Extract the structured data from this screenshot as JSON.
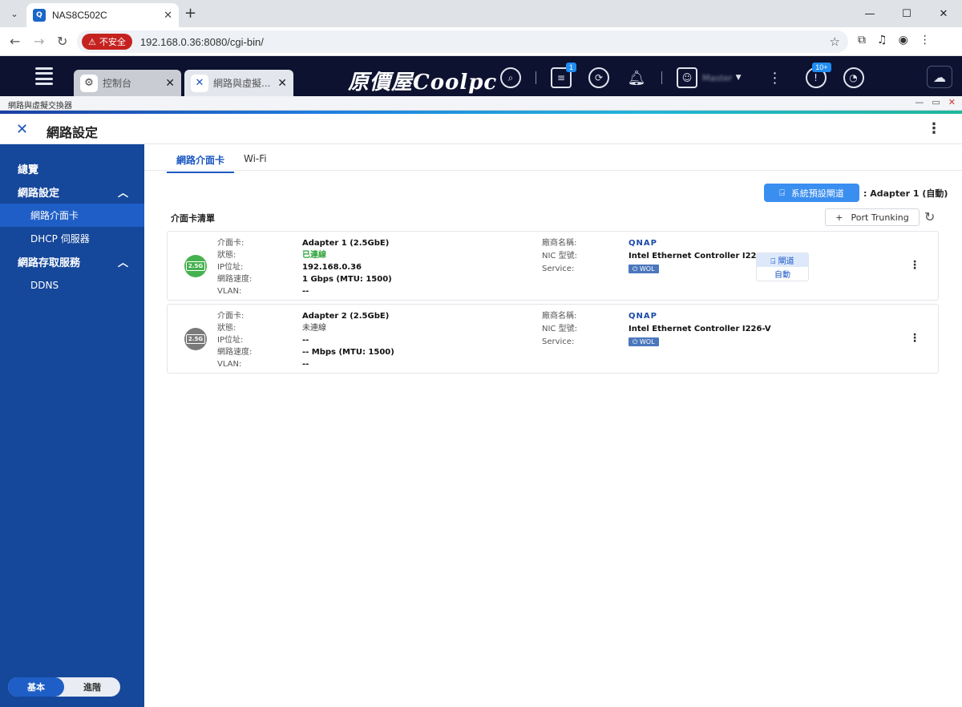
{
  "browser": {
    "tab_title": "NAS8C502C",
    "favicon_letter": "Q",
    "address_warning": "不安全",
    "url": "192.168.0.36:8080/cgi-bin/"
  },
  "topbar": {
    "app_tabs": [
      {
        "label": "控制台",
        "icon": "gear-icon"
      },
      {
        "label": "網路與虛擬...",
        "icon": "network-icon"
      }
    ],
    "brand_text": "原價屋Coolpc",
    "badges": {
      "tasks": "1",
      "notifications": "10+"
    },
    "username": "Master"
  },
  "app_window": {
    "title": "網路與虛擬交換器"
  },
  "app_header": {
    "title": "網路設定"
  },
  "sidebar": {
    "overview": "總覽",
    "network_settings": "網路設定",
    "items": [
      "網路介面卡",
      "DHCP 伺服器"
    ],
    "access_services": "網路存取服務",
    "access_items": [
      "DDNS"
    ],
    "mode_basic": "基本",
    "mode_advanced": "進階"
  },
  "main": {
    "tabs": [
      "網路介面卡",
      "Wi-Fi"
    ],
    "gateway_button": "系統預設閘道",
    "gateway_value": "Adapter 1 (自動)",
    "section_title": "介面卡清單",
    "trunk_button": "Port Trunking",
    "field_labels": {
      "adapter": "介面卡:",
      "status": "狀態:",
      "ip": "IP位址:",
      "speed": "網路速度:",
      "vlan": "VLAN:",
      "vendor": "廠商名稱:",
      "nic_model": "NIC 型號:",
      "service": "Service:"
    },
    "adapters": [
      {
        "icon_label": "2.5G",
        "name": "Adapter 1 (2.5GbE)",
        "status": "已連線",
        "ip": "192.168.0.36",
        "speed": "1 Gbps (MTU: 1500)",
        "vlan": "--",
        "vendor": "QNAP",
        "nic_model": "Intel Ethernet Controller I226-V",
        "service_tag": "WOL",
        "gateway_label": "閘道",
        "gateway_mode": "自動"
      },
      {
        "icon_label": "2.5G",
        "name": "Adapter 2 (2.5GbE)",
        "status": "未連線",
        "ip": "--",
        "speed": "-- Mbps (MTU: 1500)",
        "vlan": "--",
        "vendor": "QNAP",
        "nic_model": "Intel Ethernet Controller I226-V",
        "service_tag": "WOL"
      }
    ]
  },
  "colors": {
    "sidebar": "#15479a",
    "accent": "#1c58c2",
    "connected": "#2fa23a",
    "topbar": "#0d1230"
  }
}
